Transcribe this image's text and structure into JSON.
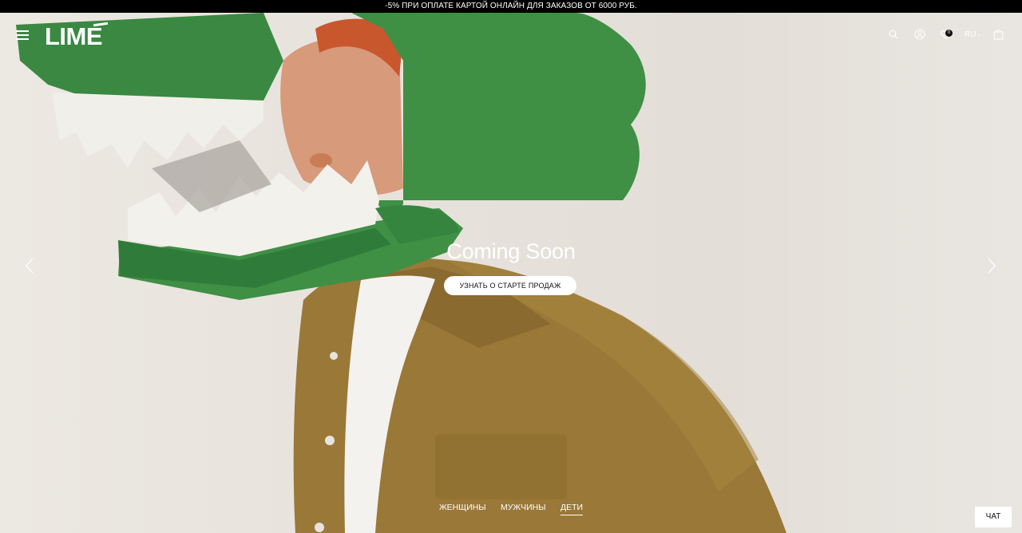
{
  "promo": {
    "text": "-5% ПРИ ОПЛАТЕ КАРТОЙ ОНЛАЙН ДЛЯ ЗАКАЗОВ ОТ 6000 РУБ."
  },
  "header": {
    "logo": "LIME",
    "wishlist_count": "0",
    "language": "RU",
    "icons": [
      "menu-icon",
      "search-icon",
      "account-icon",
      "heart-icon",
      "bag-icon"
    ]
  },
  "hero": {
    "title": "Coming Soon",
    "cta_label": "УЗНАТЬ О СТАРТЕ ПРОДАЖ",
    "image_subject": "child wearing green cardboard dinosaur head and olive corduroy jacket"
  },
  "gender_nav": {
    "items": [
      "ЖЕНЩИНЫ",
      "МУЖЧИНЫ",
      "ДЕТИ"
    ],
    "active": "ДЕТИ"
  },
  "chat": {
    "label": "ЧАТ"
  },
  "colors": {
    "promo_bg": "#000000",
    "dino_green": "#3f8f45",
    "jacket": "#9c7a3c",
    "background": "#e9e5df"
  }
}
